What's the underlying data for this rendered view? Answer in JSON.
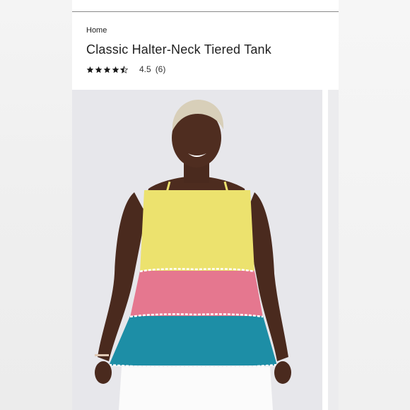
{
  "breadcrumb": {
    "home_label": "Home"
  },
  "product": {
    "title": "Classic Halter-Neck Tiered Tank",
    "rating_value": "4.5",
    "review_count": "(6)",
    "stars": [
      1,
      1,
      1,
      1,
      0.5
    ]
  },
  "colors": {
    "tier_top": "#ece26e",
    "tier_middle": "#e5778f",
    "tier_bottom": "#1d8ea6",
    "trim": "#ffffff",
    "star": "#1a1a1a"
  }
}
